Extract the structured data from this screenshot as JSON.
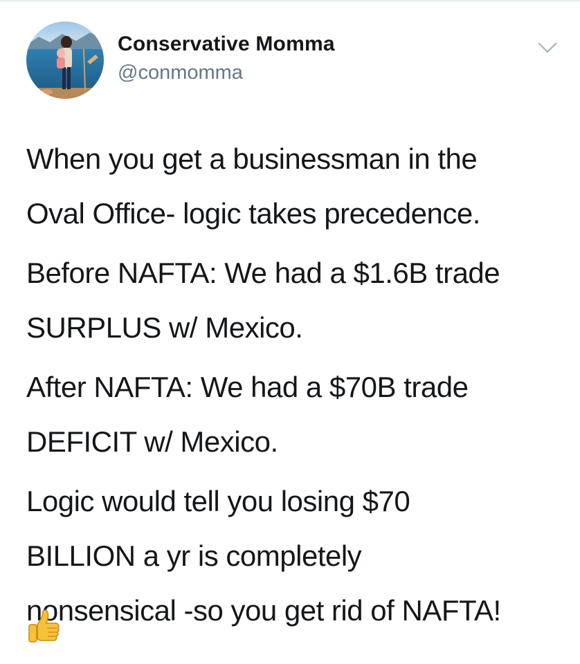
{
  "tweet": {
    "author": {
      "display_name": "Conservative Momma",
      "handle": "@conmomma",
      "avatar_icon": "profile-photo-lake"
    },
    "menu_icon": "chevron-down-icon",
    "paragraphs": [
      "When you get a businessman in the\nOval Office- logic takes precedence.",
      "Before NAFTA: We had a $1.6B trade\nSURPLUS w/ Mexico.",
      "After NAFTA: We had a $70B trade\nDEFICIT w/ Mexico.",
      "Logic would tell you losing $70\nBILLION a yr is completely\nnonsensical -so you get rid of NAFTA!"
    ],
    "emoji": "thumbs-up-icon"
  },
  "colors": {
    "text": "#14171a",
    "secondary": "#657786",
    "divider": "#e6ecf0",
    "chevron": "#aab8c2"
  }
}
